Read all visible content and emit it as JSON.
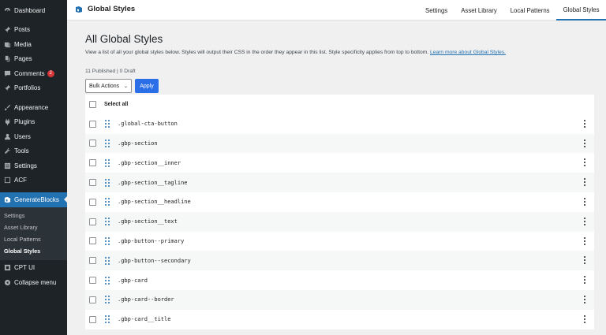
{
  "sidebar": {
    "items": [
      {
        "label": "Dashboard",
        "icon": "dashboard-icon"
      },
      {
        "label": "Posts",
        "icon": "pin-icon"
      },
      {
        "label": "Media",
        "icon": "media-icon"
      },
      {
        "label": "Pages",
        "icon": "pages-icon"
      },
      {
        "label": "Comments",
        "icon": "comment-icon",
        "badge": "2"
      },
      {
        "label": "Portfolios",
        "icon": "pin-icon"
      },
      {
        "label": "Appearance",
        "icon": "brush-icon"
      },
      {
        "label": "Plugins",
        "icon": "plug-icon"
      },
      {
        "label": "Users",
        "icon": "user-icon"
      },
      {
        "label": "Tools",
        "icon": "wrench-icon"
      },
      {
        "label": "Settings",
        "icon": "settings-icon"
      },
      {
        "label": "ACF",
        "icon": "acf-icon"
      },
      {
        "label": "GenerateBlocks",
        "icon": "generateblocks-icon"
      },
      {
        "label": "CPT UI",
        "icon": "cpt-icon"
      },
      {
        "label": "Collapse menu",
        "icon": "collapse-icon"
      }
    ],
    "submenu": [
      "Settings",
      "Asset Library",
      "Local Patterns",
      "Global Styles"
    ]
  },
  "header": {
    "brand": "Global Styles",
    "tabs": [
      "Settings",
      "Asset Library",
      "Local Patterns",
      "Global Styles"
    ]
  },
  "main": {
    "title": "All Global Styles",
    "description": "View a list of all your global styles below. Styles will output their CSS in the order they appear in this list. Style specificity applies from top to bottom.",
    "learn_more": "Learn more about Global Styles.",
    "counts": "11 Published | 0 Draft",
    "bulk_actions": "Bulk Actions",
    "apply": "Apply",
    "select_all": "Select all",
    "styles": [
      ".global-cta-button",
      ".gbp-section",
      ".gbp-section__inner",
      ".gbp-section__tagline",
      ".gbp-section__headline",
      ".gbp-section__text",
      ".gbp-button--primary",
      ".gbp-button--secondary",
      ".gbp-card",
      ".gbp-card--border",
      ".gbp-card__title"
    ]
  },
  "colors": {
    "accent": "#2271b1",
    "apply": "#2b6fe8",
    "sidebar": "#1d2327",
    "badge": "#d63638"
  }
}
